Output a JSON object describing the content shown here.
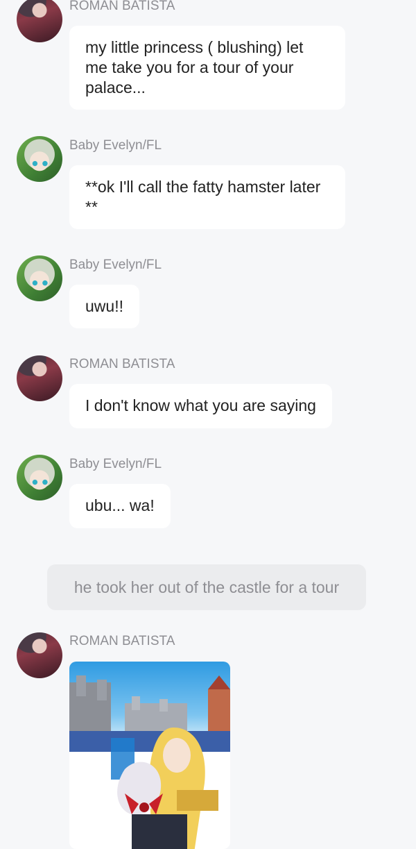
{
  "messages": [
    {
      "sender": "ROMAN BATISTA",
      "avatar": "roman-avatar",
      "text": "my little princess ( blushing) let me take you for a tour of your palace..."
    },
    {
      "sender": "Baby Evelyn/FL",
      "avatar": "evelyn-avatar",
      "text": "**ok I'll call the fatty hamster later **"
    },
    {
      "sender": "Baby Evelyn/FL",
      "avatar": "evelyn-avatar",
      "text": "uwu!!"
    },
    {
      "sender": "ROMAN BATISTA",
      "avatar": "roman-avatar",
      "text": "I don't know what you are saying"
    },
    {
      "sender": "Baby Evelyn/FL",
      "avatar": "evelyn-avatar",
      "text": "ubu... wa!"
    },
    {
      "sender": "ROMAN BATISTA",
      "avatar": "roman-avatar",
      "image": "manhwa-castle-panel"
    }
  ],
  "narration": {
    "text": "he took her out of the castle for a tour"
  },
  "colors": {
    "background": "#f6f7f9",
    "bubble": "#ffffff",
    "narration_bubble": "#ebecee",
    "sender_text": "#8e8e93",
    "message_text": "#222222"
  }
}
